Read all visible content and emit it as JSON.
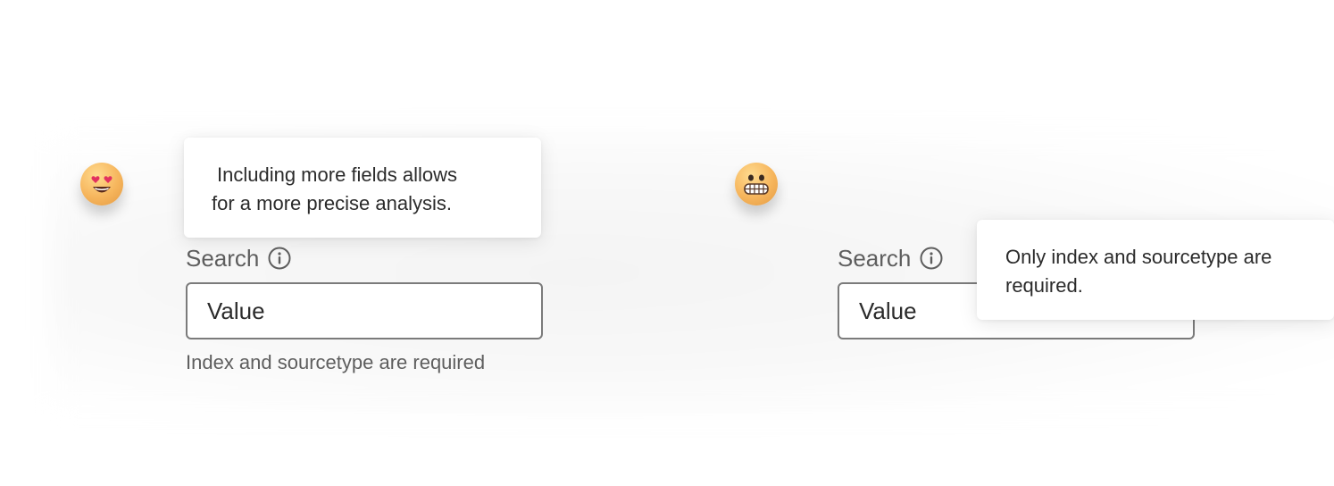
{
  "left_example": {
    "emoji": "heart-eyes-emoji",
    "tooltip_lines": [
      "Including more fields allows",
      "for a more precise analysis."
    ],
    "field_label": "Search",
    "info_icon": "info-icon",
    "input_value": "Value",
    "help_text": "Index and sourcetype are required"
  },
  "right_example": {
    "emoji": "grimacing-emoji",
    "field_label": "Search",
    "info_icon": "info-icon",
    "input_value": "Value",
    "tooltip_lines": [
      "Only index and sourcetype are",
      "required."
    ]
  },
  "colors": {
    "label": "#5e5e5e",
    "text": "#2b2b2b",
    "input_border": "#7b7b7b",
    "emoji_face": "#f6b55c",
    "heart": "#e2315f"
  }
}
